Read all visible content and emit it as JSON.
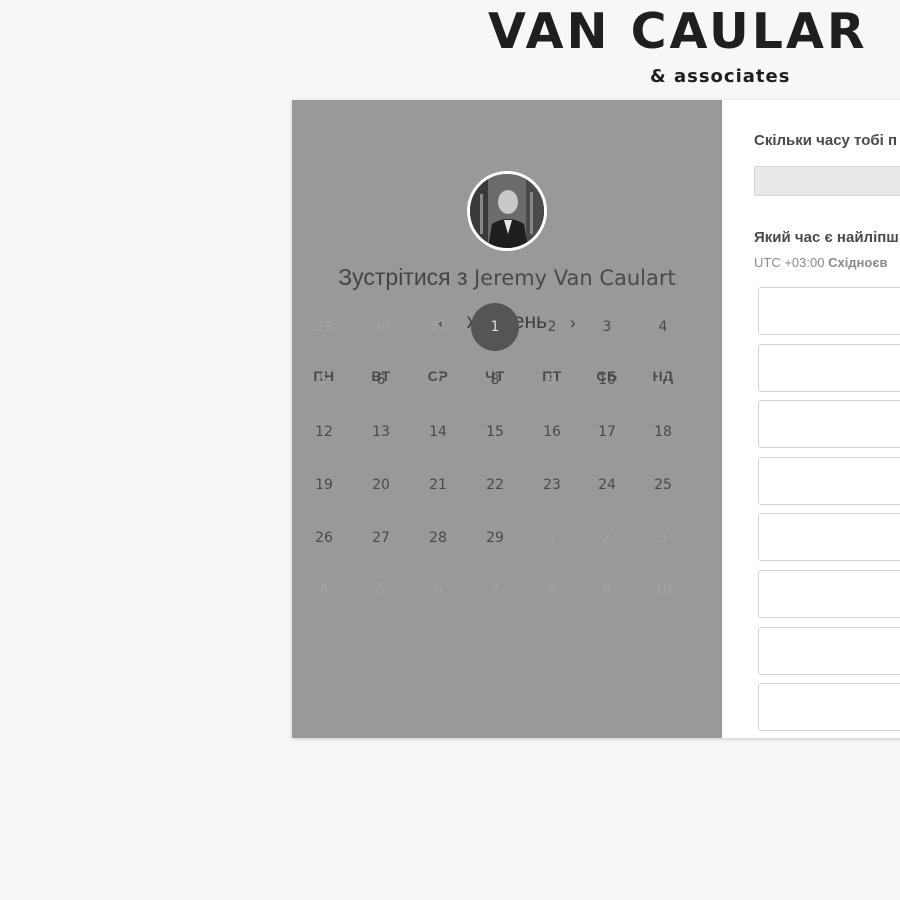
{
  "brand": {
    "name": "VAN CAULAR",
    "tagline": "& associates"
  },
  "host": {
    "meet_prefix": "Зустрітися з",
    "name": "Jeremy Van Caulart"
  },
  "calendar": {
    "month": "жовтень",
    "prev_icon": "chevron-left-icon",
    "next_icon": "chevron-right-icon",
    "weekdays": [
      "ПН",
      "ВТ",
      "СР",
      "ЧТ",
      "ПТ",
      "СБ",
      "НД"
    ],
    "weeks": [
      [
        {
          "d": "29",
          "m": true
        },
        {
          "d": "30",
          "m": true
        },
        {
          "d": "31",
          "m": true
        },
        {
          "d": "1",
          "s": true
        },
        {
          "d": "2"
        },
        {
          "d": "3"
        },
        {
          "d": "4"
        }
      ],
      [
        {
          "d": "5",
          "m": true
        },
        {
          "d": "6"
        },
        {
          "d": "7",
          "m": true
        },
        {
          "d": "8"
        },
        {
          "d": "9",
          "m": true
        },
        {
          "d": "10"
        },
        {
          "d": "11",
          "m": true
        }
      ],
      [
        {
          "d": "12"
        },
        {
          "d": "13"
        },
        {
          "d": "14"
        },
        {
          "d": "15"
        },
        {
          "d": "16"
        },
        {
          "d": "17"
        },
        {
          "d": "18"
        }
      ],
      [
        {
          "d": "19"
        },
        {
          "d": "20"
        },
        {
          "d": "21"
        },
        {
          "d": "22"
        },
        {
          "d": "23"
        },
        {
          "d": "24"
        },
        {
          "d": "25"
        }
      ],
      [
        {
          "d": "26"
        },
        {
          "d": "27"
        },
        {
          "d": "28"
        },
        {
          "d": "29"
        },
        {
          "d": "1",
          "m": true
        },
        {
          "d": "2",
          "m": true
        },
        {
          "d": "3",
          "m": true
        }
      ],
      [
        {
          "d": "4",
          "m": true
        },
        {
          "d": "5",
          "m": true
        },
        {
          "d": "6",
          "m": true
        },
        {
          "d": "7",
          "m": true
        },
        {
          "d": "8",
          "m": true
        },
        {
          "d": "9",
          "m": true
        },
        {
          "d": "10",
          "m": true
        }
      ]
    ]
  },
  "booking": {
    "duration_question": "Скільки часу тобі п",
    "time_question": "Який час є найліпш",
    "timezone_offset": "UTC +03:00",
    "timezone_name": "Східноєв",
    "slot_count": 8
  },
  "colors": {
    "left_panel": "#999999",
    "selected_day": "#555555",
    "page_bg": "#f7f7f7"
  }
}
